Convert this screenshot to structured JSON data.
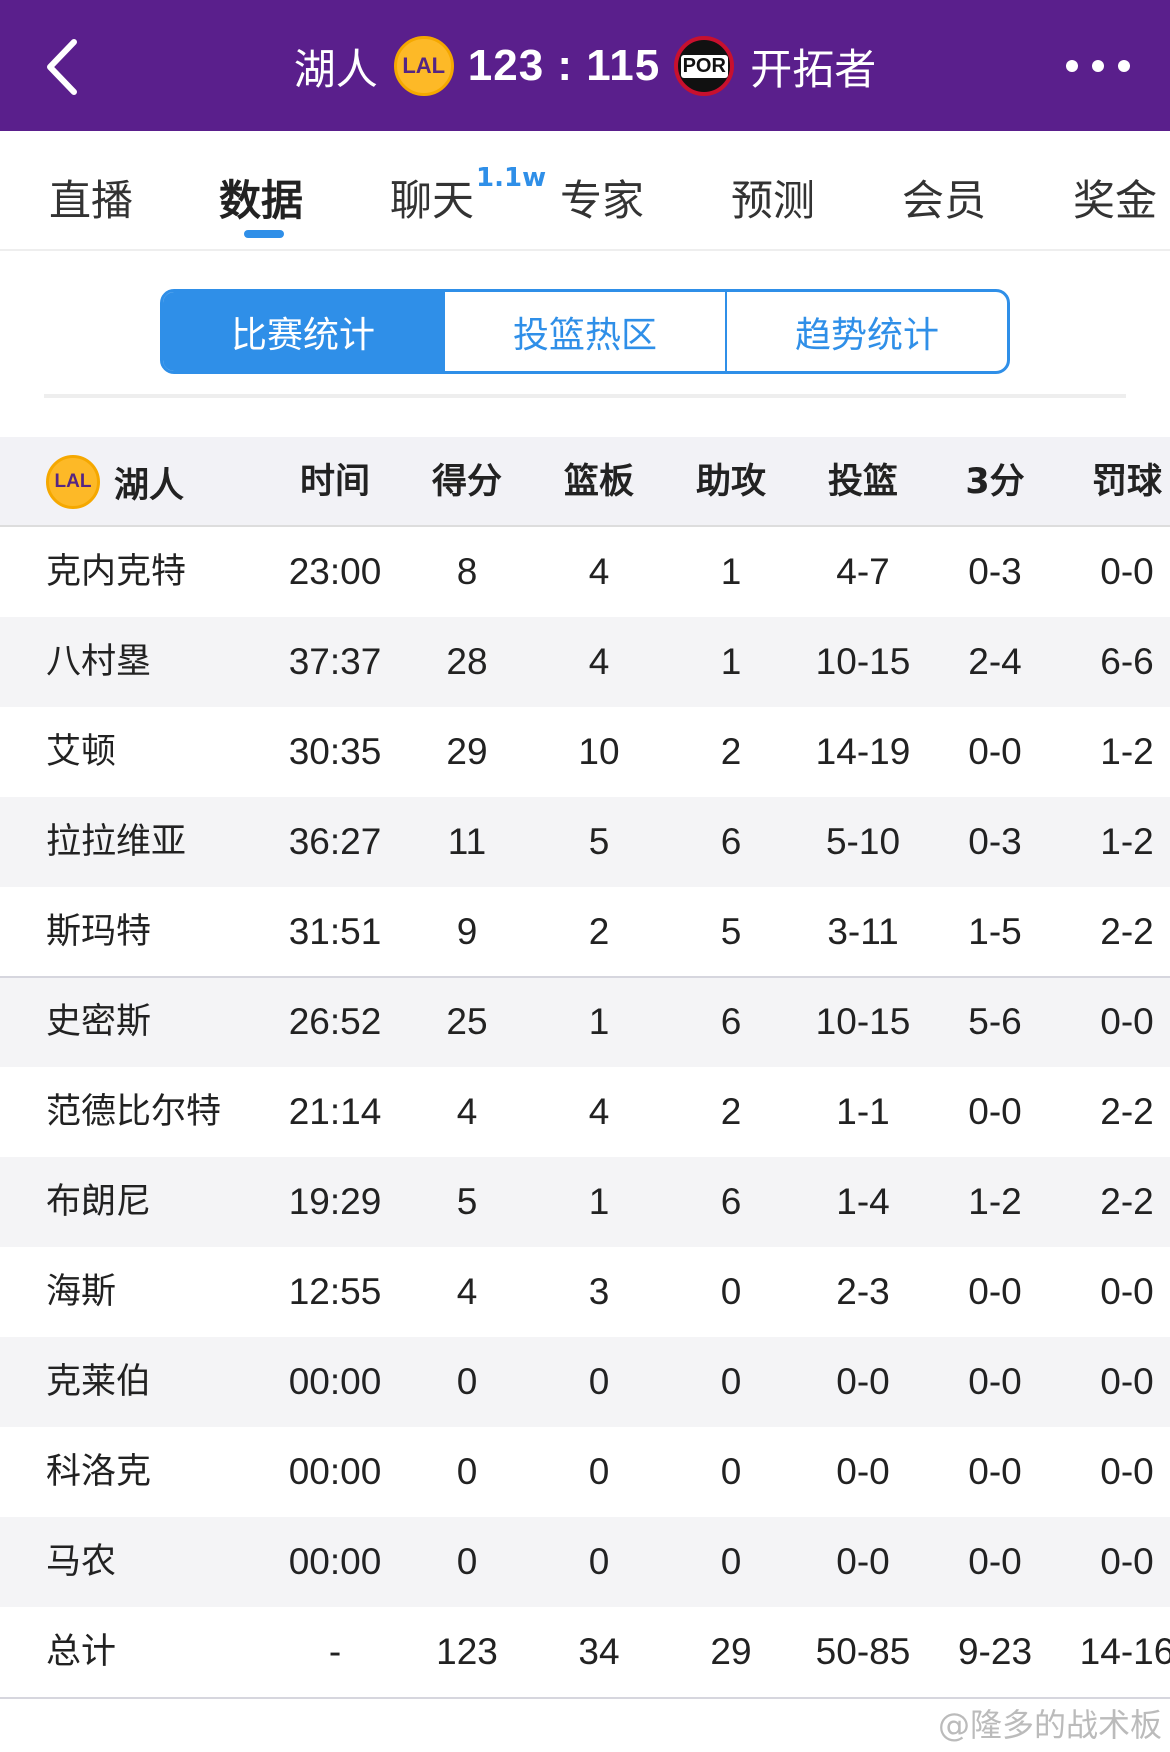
{
  "header": {
    "home_team": "湖人",
    "home_logo_text": "LAL",
    "score": "123 : 115",
    "away_logo_text": "POR",
    "away_team": "开拓者",
    "colors": {
      "bar": "#5a1f8c"
    }
  },
  "tabs": [
    {
      "label": "直播"
    },
    {
      "label": "数据"
    },
    {
      "label": "聊天",
      "badge": "1.1w"
    },
    {
      "label": "专家"
    },
    {
      "label": "预测"
    },
    {
      "label": "会员"
    },
    {
      "label": "奖金"
    }
  ],
  "active_tab": "数据",
  "segments": [
    "比赛统计",
    "投篮热区",
    "趋势统计"
  ],
  "active_segment": "比赛统计",
  "table": {
    "team": "湖人",
    "team_logo_text": "LAL",
    "columns": [
      "时间",
      "得分",
      "篮板",
      "助攻",
      "投篮",
      "3分",
      "罚球"
    ],
    "rows": [
      [
        "克内克特",
        "23:00",
        "8",
        "4",
        "1",
        "4-7",
        "0-3",
        "0-0"
      ],
      [
        "八村塁",
        "37:37",
        "28",
        "4",
        "1",
        "10-15",
        "2-4",
        "6-6"
      ],
      [
        "艾顿",
        "30:35",
        "29",
        "10",
        "2",
        "14-19",
        "0-0",
        "1-2"
      ],
      [
        "拉拉维亚",
        "36:27",
        "11",
        "5",
        "6",
        "5-10",
        "0-3",
        "1-2"
      ],
      [
        "斯玛特",
        "31:51",
        "9",
        "2",
        "5",
        "3-11",
        "1-5",
        "2-2"
      ],
      [
        "史密斯",
        "26:52",
        "25",
        "1",
        "6",
        "10-15",
        "5-6",
        "0-0"
      ],
      [
        "范德比尔特",
        "21:14",
        "4",
        "4",
        "2",
        "1-1",
        "0-0",
        "2-2"
      ],
      [
        "布朗尼",
        "19:29",
        "5",
        "1",
        "6",
        "1-4",
        "1-2",
        "2-2"
      ],
      [
        "海斯",
        "12:55",
        "4",
        "3",
        "0",
        "2-3",
        "0-0",
        "0-0"
      ],
      [
        "克莱伯",
        "00:00",
        "0",
        "0",
        "0",
        "0-0",
        "0-0",
        "0-0"
      ],
      [
        "科洛克",
        "00:00",
        "0",
        "0",
        "0",
        "0-0",
        "0-0",
        "0-0"
      ],
      [
        "马农",
        "00:00",
        "0",
        "0",
        "0",
        "0-0",
        "0-0",
        "0-0"
      ],
      [
        "总计",
        "-",
        "123",
        "34",
        "29",
        "50-85",
        "9-23",
        "14-16"
      ]
    ]
  },
  "watermark": "@隆多的战术板"
}
